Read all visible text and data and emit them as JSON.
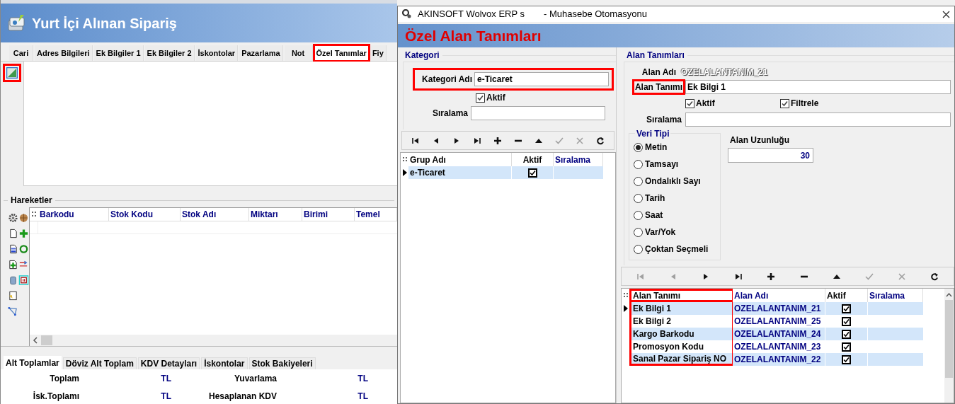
{
  "main_window": {
    "title": "Yurt İçi Alınan Sipariş",
    "tabs": [
      {
        "label": "Cari",
        "selected": false,
        "highlighted": false
      },
      {
        "label": "Adres Bilgileri",
        "selected": false,
        "highlighted": false
      },
      {
        "label": "Ek Bilgiler 1",
        "selected": false,
        "highlighted": false
      },
      {
        "label": "Ek Bilgiler 2",
        "selected": false,
        "highlighted": false
      },
      {
        "label": "İskontolar",
        "selected": false,
        "highlighted": false
      },
      {
        "label": "Pazarlama",
        "selected": false,
        "highlighted": false
      },
      {
        "label": "Not",
        "selected": false,
        "highlighted": false
      },
      {
        "label": "Özel Tanımlar",
        "selected": true,
        "highlighted": true
      },
      {
        "label": "Fiy",
        "selected": false,
        "highlighted": false
      }
    ],
    "image_button": {
      "highlighted": true
    },
    "hareketler": {
      "title": "Hareketler",
      "columns": [
        "Barkodu",
        "Stok Kodu",
        "Stok Adı",
        "Miktarı",
        "Birimi",
        "Temel"
      ]
    },
    "bottom_tabs": [
      {
        "label": "Alt Toplamlar",
        "selected": true
      },
      {
        "label": "Döviz Alt Toplam",
        "selected": false
      },
      {
        "label": "KDV Detayları",
        "selected": false
      },
      {
        "label": "İskontolar",
        "selected": false
      },
      {
        "label": "Stok Bakiyeleri",
        "selected": false
      }
    ],
    "totals": [
      [
        "Toplam",
        "TL",
        "Yuvarlama",
        "TL"
      ],
      [
        "İsk.Toplamı",
        "TL",
        "Hesaplanan KDV",
        "TL"
      ]
    ]
  },
  "dialog": {
    "app_title": "AKINSOFT Wolvox ERP s",
    "app_subtitle": "- Muhasebe Otomasyonu",
    "header": "Özel Alan Tanımları",
    "kategori": {
      "title": "Kategori",
      "name_label": "Kategori Adı",
      "name_value": "e-Ticaret",
      "name_highlighted": true,
      "aktif_label": "Aktif",
      "aktif": true,
      "order_label": "Sıralama",
      "toolbar": [
        {
          "kind": "first",
          "disabled": false
        },
        {
          "kind": "prev",
          "disabled": false
        },
        {
          "kind": "next",
          "disabled": false
        },
        {
          "kind": "last",
          "disabled": false
        },
        {
          "kind": "add",
          "disabled": false
        },
        {
          "kind": "delete",
          "disabled": false
        },
        {
          "kind": "up",
          "disabled": false
        },
        {
          "kind": "post",
          "disabled": true
        },
        {
          "kind": "cancel",
          "disabled": true
        },
        {
          "kind": "refresh",
          "disabled": false
        }
      ],
      "columns": [
        {
          "label": "Grup Adı",
          "color": "#000000"
        },
        {
          "label": "Aktif",
          "color": "#000000"
        },
        {
          "label": "Sıralama",
          "color": "#000080"
        }
      ],
      "rows": [
        {
          "name": "e-Ticaret",
          "aktif": true,
          "current": true
        }
      ]
    },
    "alan": {
      "title": "Alan Tanımları",
      "alan_adi_label": "Alan Adı",
      "alan_adi": "OZELALANTANIM_21",
      "tanim_label": "Alan Tanımı",
      "tanim_highlighted": true,
      "tanim_value": "Ek Bilgi 1",
      "aktif_label": "Aktif",
      "aktif": true,
      "filtrele_label": "Filtrele",
      "filtrele": true,
      "order_label": "Sıralama",
      "veri_tipi_title": "Veri Tipi",
      "veri_tipi": [
        {
          "label": "Metin",
          "selected": true
        },
        {
          "label": "Tamsayı",
          "selected": false
        },
        {
          "label": "Ondalıklı Sayı",
          "selected": false
        },
        {
          "label": "Tarih",
          "selected": false
        },
        {
          "label": "Saat",
          "selected": false
        },
        {
          "label": "Var/Yok",
          "selected": false
        },
        {
          "label": "Çoktan Seçmeli",
          "selected": false
        }
      ],
      "length_label": "Alan Uzunluğu",
      "length_value": "30",
      "toolbar": [
        {
          "kind": "first",
          "disabled": true
        },
        {
          "kind": "prev",
          "disabled": true
        },
        {
          "kind": "next",
          "disabled": false
        },
        {
          "kind": "last",
          "disabled": false
        },
        {
          "kind": "add",
          "disabled": false
        },
        {
          "kind": "delete",
          "disabled": false
        },
        {
          "kind": "up",
          "disabled": false
        },
        {
          "kind": "post",
          "disabled": true
        },
        {
          "kind": "cancel",
          "disabled": true
        },
        {
          "kind": "refresh",
          "disabled": false
        }
      ],
      "columns": [
        {
          "label": "Alan Tanımı",
          "color": "#000000",
          "highlighted": true
        },
        {
          "label": "Alan Adı",
          "color": "#000080",
          "highlighted": false
        },
        {
          "label": "Aktif",
          "color": "#000000",
          "highlighted": false
        },
        {
          "label": "Sıralama",
          "color": "#000080",
          "highlighted": false
        }
      ],
      "rows": [
        {
          "tanim": "Ek Bilgi 1",
          "adi": "OZELALANTANIM_21",
          "aktif": true,
          "current": true
        },
        {
          "tanim": "Ek Bilgi 2",
          "adi": "OZELALANTANIM_25",
          "aktif": true,
          "current": false
        },
        {
          "tanim": "Kargo Barkodu",
          "adi": "OZELALANTANIM_24",
          "aktif": true,
          "current": false
        },
        {
          "tanim": "Promosyon Kodu",
          "adi": "OZELALANTANIM_23",
          "aktif": true,
          "current": false
        },
        {
          "tanim": "Sanal Pazar Sipariş NO",
          "adi": "OZELALANTANIM_22",
          "aktif": true,
          "current": false
        }
      ]
    }
  }
}
